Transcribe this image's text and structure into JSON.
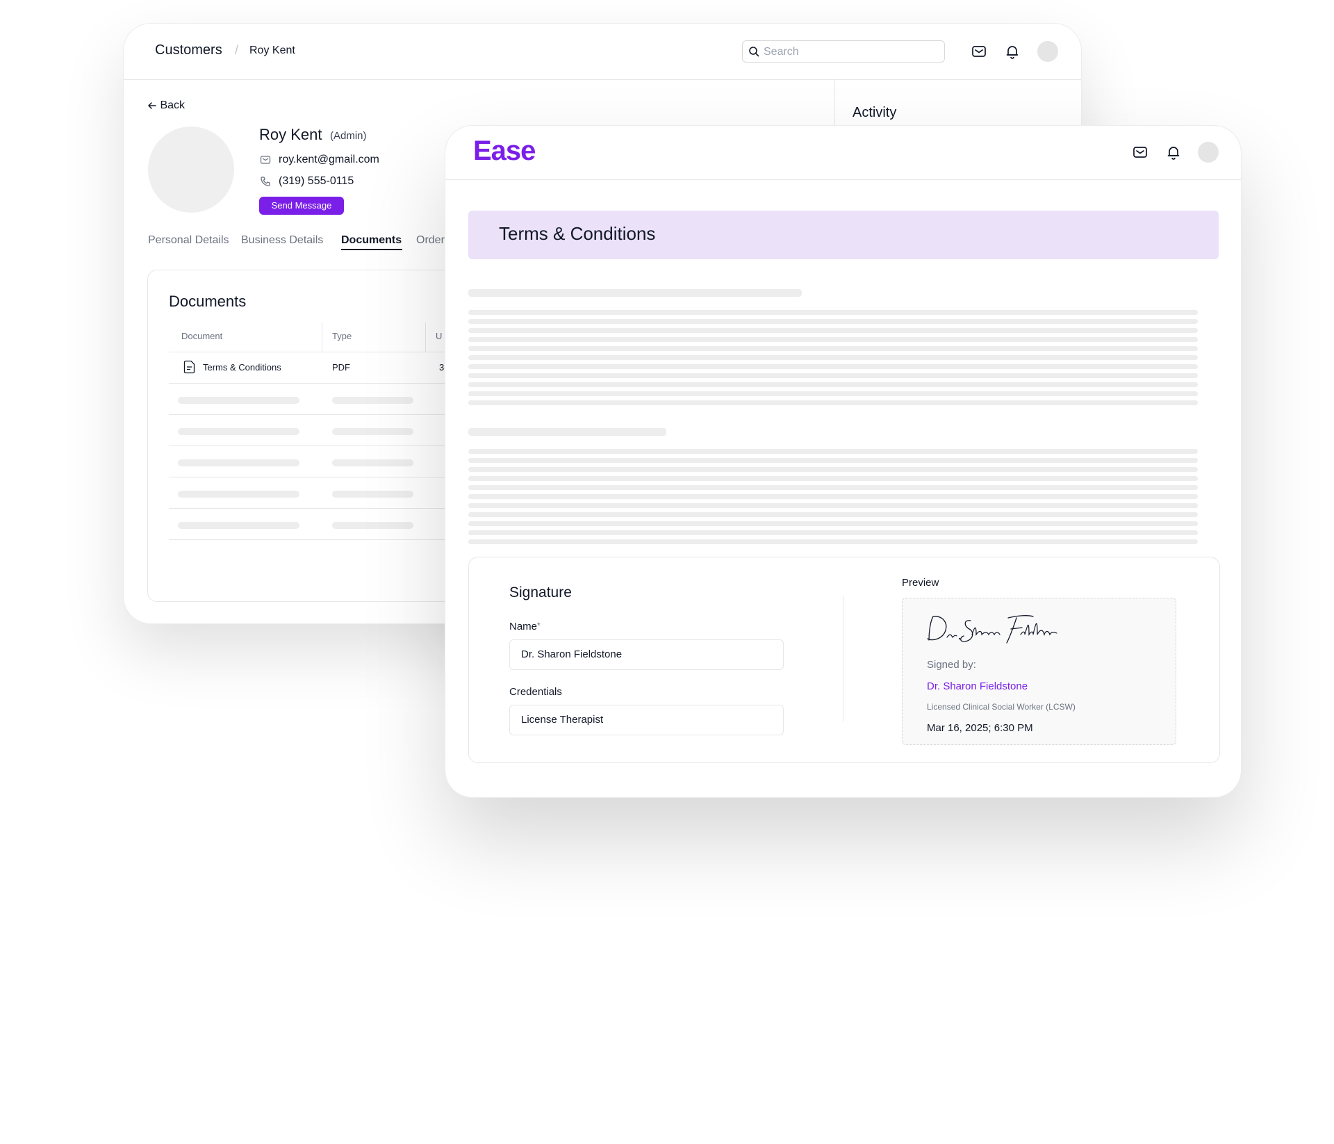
{
  "back_window": {
    "breadcrumb": {
      "root": "Customers",
      "separator": "/",
      "current": "Roy Kent"
    },
    "search": {
      "placeholder": "Search"
    },
    "activity_title": "Activity",
    "back_label": "Back",
    "profile": {
      "name": "Roy Kent",
      "role": "(Admin)",
      "email": "roy.kent@gmail.com",
      "phone": "(319) 555-0115",
      "send_button": "Send Message"
    },
    "tabs": [
      "Personal Details",
      "Business Details",
      "Documents",
      "Order"
    ],
    "active_tab": "Documents",
    "documents": {
      "title": "Documents",
      "columns": [
        "Document",
        "Type",
        "U"
      ],
      "rows": [
        {
          "name": "Terms & Conditions",
          "type": "PDF",
          "extra": "3"
        }
      ]
    }
  },
  "front_window": {
    "logo": "Ease",
    "banner_title": "Terms & Conditions",
    "signature": {
      "title": "Signature",
      "name_label": "Name",
      "required_mark": "*",
      "name_value": "Dr. Sharon Fieldstone",
      "credentials_label": "Credentials",
      "credentials_value": "License Therapist"
    },
    "preview": {
      "label": "Preview",
      "handwritten": "Dr. Sharon Fieldstone",
      "signed_by_label": "Signed by:",
      "signer_name": "Dr. Sharon Fieldstone",
      "credential": "Licensed Clinical Social Worker (LCSW)",
      "timestamp": "Mar 16, 2025; 6:30 PM"
    }
  },
  "colors": {
    "brand": "#7a1fe8",
    "banner": "#ebe1f8"
  },
  "icons": [
    "search-icon",
    "mail-icon",
    "bell-icon",
    "arrow-left-icon",
    "phone-icon",
    "file-icon"
  ]
}
